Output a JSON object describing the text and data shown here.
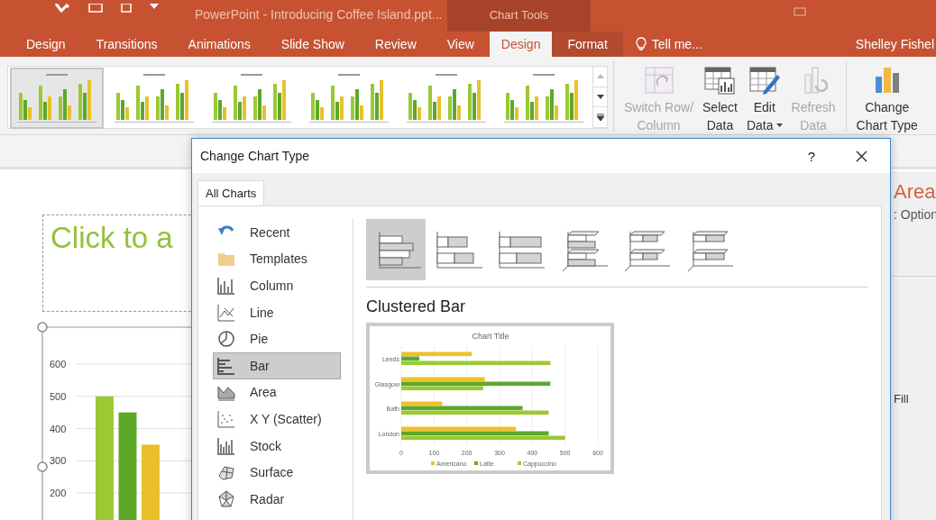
{
  "title_bar": {
    "title": "PowerPoint - Introducing Coffee Island.ppt...",
    "context_label": "Chart Tools"
  },
  "ribbon_tabs": [
    {
      "label": "Design",
      "selected": false,
      "contextual": false
    },
    {
      "label": "Transitions",
      "selected": false,
      "contextual": false
    },
    {
      "label": "Animations",
      "selected": false,
      "contextual": false
    },
    {
      "label": "Slide Show",
      "selected": false,
      "contextual": false
    },
    {
      "label": "Review",
      "selected": false,
      "contextual": false
    },
    {
      "label": "View",
      "selected": false,
      "contextual": false
    },
    {
      "label": "Design",
      "selected": true,
      "contextual": true
    },
    {
      "label": "Format",
      "selected": false,
      "contextual": true
    }
  ],
  "tell_me": "Tell me...",
  "user": "Shelley Fishel",
  "chart_styles": [
    {
      "selected": true
    },
    {
      "selected": false
    },
    {
      "selected": false
    },
    {
      "selected": false
    },
    {
      "selected": false
    },
    {
      "selected": false
    }
  ],
  "ribbon_buttons": [
    {
      "kind": "switch",
      "lines": [
        "Switch Row/",
        "Column"
      ],
      "disabled": true,
      "dropdown": false
    },
    {
      "kind": "select",
      "lines": [
        "Select",
        "Data"
      ],
      "disabled": false,
      "dropdown": false
    },
    {
      "kind": "edit",
      "lines": [
        "Edit",
        "Data"
      ],
      "disabled": false,
      "dropdown": true
    },
    {
      "kind": "refresh",
      "lines": [
        "Refresh",
        "Data"
      ],
      "disabled": true,
      "dropdown": false
    },
    {
      "kind": "change",
      "lines": [
        "Change",
        "Chart Type"
      ],
      "disabled": false,
      "dropdown": false
    }
  ],
  "slide": {
    "title_placeholder": "Click to a",
    "chart_data": {
      "type": "bar",
      "ylim": [
        0,
        600
      ],
      "grid": true,
      "yticks": [
        200,
        300,
        400,
        500,
        600
      ],
      "series": [
        {
          "color": "#9bc934",
          "values": [
            500
          ]
        },
        {
          "color": "#5ea829",
          "values": [
            450
          ]
        },
        {
          "color": "#e9c02a",
          "values": [
            350
          ]
        }
      ]
    }
  },
  "dialog": {
    "title": "Change Chart Type",
    "help": "?",
    "tabs": [
      {
        "label": "All Charts",
        "selected": true
      }
    ],
    "chart_types": [
      {
        "kind": "recent",
        "label": "Recent",
        "selected": false
      },
      {
        "kind": "templates",
        "label": "Templates",
        "selected": false
      },
      {
        "kind": "column",
        "label": "Column",
        "selected": false
      },
      {
        "kind": "line",
        "label": "Line",
        "selected": false
      },
      {
        "kind": "pie",
        "label": "Pie",
        "selected": false
      },
      {
        "kind": "bar",
        "label": "Bar",
        "selected": true
      },
      {
        "kind": "area",
        "label": "Area",
        "selected": false
      },
      {
        "kind": "scatter",
        "label": "X Y (Scatter)",
        "selected": false
      },
      {
        "kind": "stock",
        "label": "Stock",
        "selected": false
      },
      {
        "kind": "surface",
        "label": "Surface",
        "selected": false
      },
      {
        "kind": "radar",
        "label": "Radar",
        "selected": false
      }
    ],
    "subtypes": [
      {
        "kind": "clustered",
        "selected": true
      },
      {
        "kind": "stacked",
        "selected": false
      },
      {
        "kind": "stacked100",
        "selected": false
      },
      {
        "kind": "clustered3d",
        "selected": false
      },
      {
        "kind": "stacked3d",
        "selected": false
      },
      {
        "kind": "stacked100_3d",
        "selected": false
      }
    ],
    "subtype_title": "Clustered Bar",
    "preview": {
      "chart_data": {
        "type": "bar",
        "orientation": "horizontal",
        "title": "Chart Title",
        "categories": [
          "Leeds",
          "Glasgow",
          "Bath",
          "London"
        ],
        "series": [
          {
            "name": "Americano",
            "color": "#eec12a",
            "values": [
              215,
              255,
              125,
              350
            ]
          },
          {
            "name": "Latte",
            "color": "#5ea829",
            "values": [
              55,
              455,
              370,
              450
            ]
          },
          {
            "name": "Cappuccino",
            "color": "#9bc934",
            "values": [
              455,
              250,
              450,
              500
            ]
          }
        ],
        "xlim": [
          0,
          600
        ],
        "xticks": [
          0,
          100,
          200,
          300,
          400,
          500,
          600
        ],
        "grid": true,
        "legend": true
      }
    }
  },
  "format_pane": {
    "heading": "Area",
    "subheading": ": Option",
    "item": "Fill"
  }
}
